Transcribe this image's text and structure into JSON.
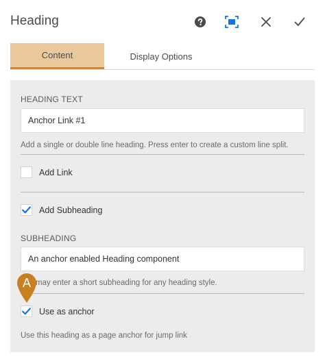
{
  "header": {
    "title": "Heading"
  },
  "tabs": [
    {
      "label": "Content",
      "active": true
    },
    {
      "label": "Display Options",
      "active": false
    }
  ],
  "form": {
    "heading_label": "HEADING TEXT",
    "heading_value": "Anchor Link #1",
    "heading_help": "Add a single or double line heading. Press enter to create a custom line split.",
    "add_link_label": "Add Link",
    "add_link_checked": false,
    "add_subheading_label": "Add Subheading",
    "add_subheading_checked": true,
    "subheading_label": "SUBHEADING",
    "subheading_value": "An anchor enabled Heading component",
    "subheading_help": "may enter a short subheading for any heading style.",
    "use_anchor_label": "Use as anchor",
    "use_anchor_checked": true,
    "use_anchor_help": "Use this heading as a page anchor for jump link"
  },
  "callout": {
    "letter": "A"
  },
  "colors": {
    "accent": "#1473e6",
    "tab_active_bg": "#ebc89c",
    "tab_active_border": "#c68a3e",
    "panel_bg": "#ececec",
    "marker": "#c9811f"
  }
}
